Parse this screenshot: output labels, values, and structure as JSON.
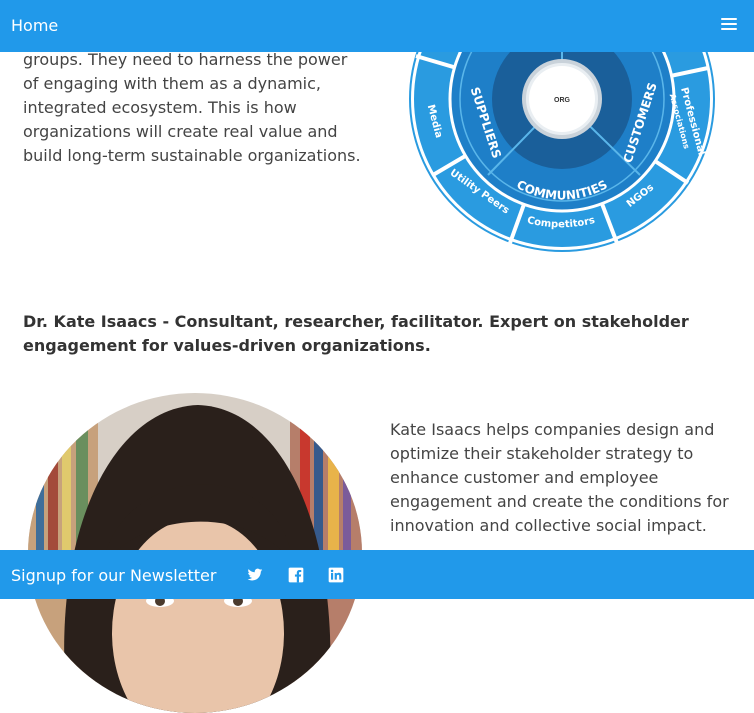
{
  "nav": {
    "home_label": "Home"
  },
  "intro": {
    "text": "groups. They need to harness the power of engaging with them as a dynamic, integrated ecosystem. This is how organizations will create real value and build long-term sustainable organizations."
  },
  "wheel": {
    "center": "ORG",
    "inner_labels": [
      "SUPPLIERS",
      "COMMUNITIES",
      "CUSTOMERS"
    ],
    "outer_labels": [
      "Media",
      "Utility Peers",
      "Competitors",
      "NGOs",
      "Professional",
      "Associations"
    ],
    "colors": {
      "dark": "#1a5f9a",
      "mid": "#1e7fc8",
      "light": "#2a9be0",
      "ring": "#5ab6ea"
    }
  },
  "bio": {
    "heading": "Dr. Kate Isaacs - Consultant, researcher, facilitator. Expert on stakeholder engagement for values-driven organizations.",
    "text": "Kate Isaacs helps companies design and optimize their stakeholder strategy to enhance customer and employee engagement and create the conditions for innovation and collective social impact."
  },
  "footer": {
    "signup_label": "Signup for our Newsletter",
    "icons": [
      "twitter-icon",
      "facebook-icon",
      "linkedin-icon"
    ]
  },
  "theme": {
    "accent": "#2199ea"
  }
}
